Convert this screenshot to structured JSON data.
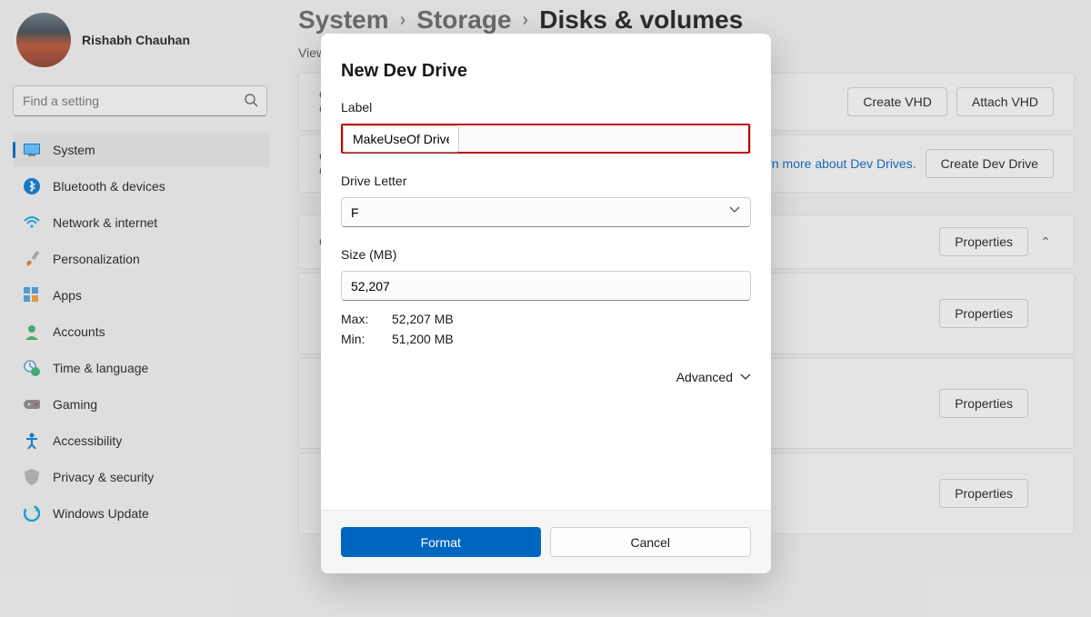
{
  "profile": {
    "name": "Rishabh Chauhan"
  },
  "search": {
    "placeholder": "Find a setting"
  },
  "sidebar": {
    "items": [
      {
        "label": "System"
      },
      {
        "label": "Bluetooth & devices"
      },
      {
        "label": "Network & internet"
      },
      {
        "label": "Personalization"
      },
      {
        "label": "Apps"
      },
      {
        "label": "Accounts"
      },
      {
        "label": "Time & language"
      },
      {
        "label": "Gaming"
      },
      {
        "label": "Accessibility"
      },
      {
        "label": "Privacy & security"
      },
      {
        "label": "Windows Update"
      }
    ]
  },
  "breadcrumb": {
    "a": "System",
    "b": "Storage",
    "c": "Disks & volumes",
    "sep": "›"
  },
  "subtitle": "View",
  "cards": {
    "c1": {
      "left1": "C",
      "left2": "C",
      "btn1": "Create VHD",
      "btn2": "Attach VHD"
    },
    "c2": {
      "left1": "C",
      "left2": "O",
      "link": "rn more about Dev Drives.",
      "btn": "Create Dev Drive"
    },
    "c3": {
      "left": "C",
      "btn": "Properties"
    },
    "c4": {
      "btn": "Properties"
    },
    "c5": {
      "btn": "Properties"
    },
    "c6": {
      "btn": "Properties"
    }
  },
  "dialog": {
    "title": "New Dev Drive",
    "label_field": "Label",
    "label_value": "MakeUseOf Drive",
    "letter_field": "Drive Letter",
    "letter_value": "F",
    "size_field": "Size (MB)",
    "size_value": "52,207",
    "max_label": "Max:",
    "max_value": "52,207 MB",
    "min_label": "Min:",
    "min_value": "51,200 MB",
    "advanced": "Advanced",
    "format_btn": "Format",
    "cancel_btn": "Cancel"
  }
}
